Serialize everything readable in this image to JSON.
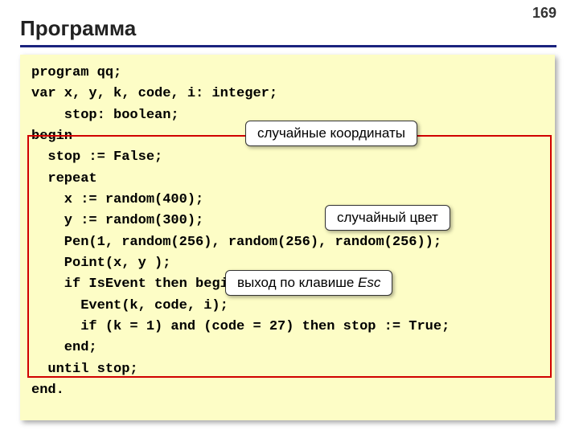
{
  "page_number": "169",
  "title": "Программа",
  "code_lines": [
    "program qq;",
    "var x, y, k, code, i: integer;",
    "    stop: boolean;",
    "begin",
    "  stop := False;",
    "  repeat",
    "    x := random(400);",
    "    y := random(300);",
    "    Pen(1, random(256), random(256), random(256));",
    "    Point(x, y );",
    "    if IsEvent then begin",
    "      Event(k, code, i);",
    "      if (k = 1) and (code = 27) then stop := True;",
    "    end;",
    "  until stop;",
    "end."
  ],
  "callouts": {
    "c1": "случайные координаты",
    "c2": "случайный цвет",
    "c3_prefix": "выход по клавише ",
    "c3_em": "Esc"
  }
}
